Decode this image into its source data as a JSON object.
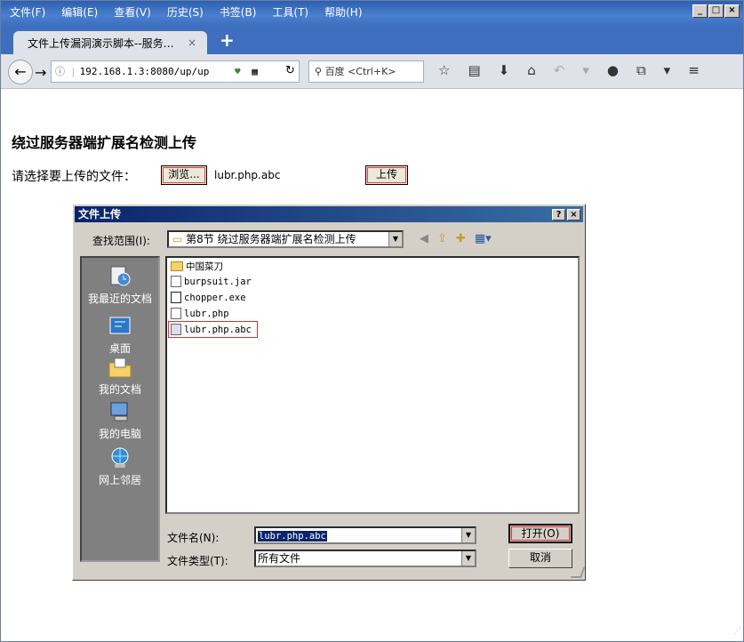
{
  "menubar": {
    "items": [
      "文件(F)",
      "编辑(E)",
      "查看(V)",
      "历史(S)",
      "书签(B)",
      "工具(T)",
      "帮助(H)"
    ],
    "window_controls": [
      "_",
      "□",
      "×"
    ]
  },
  "tab": {
    "title": "文件上传漏洞演示脚本--服务…",
    "close": "×",
    "new_tab": "+"
  },
  "navbar": {
    "url": "192.168.1.3:8080/up/up",
    "search_placeholder": "百度 <Ctrl+K>"
  },
  "page": {
    "heading": "绕过服务器端扩展名检测上传",
    "prompt": "请选择要上传的文件：",
    "browse_label": "浏览...",
    "chosen_file": "lubr.php.abc",
    "upload_label": "上传"
  },
  "dialog": {
    "title": "文件上传",
    "title_buttons": [
      "?",
      "×"
    ],
    "look_in_label": "查找范围(I):",
    "look_in_value": "第8节 绕过服务器端扩展名检测上传",
    "places": [
      "我最近的文档",
      "桌面",
      "我的文档",
      "我的电脑",
      "网上邻居"
    ],
    "files": [
      "中国菜刀",
      "burpsuit.jar",
      "chopper.exe",
      "lubr.php",
      "lubr.php.abc"
    ],
    "filename_label": "文件名(N):",
    "filename_value": "lubr.php.abc",
    "filetype_label": "文件类型(T):",
    "filetype_value": "所有文件",
    "open_label": "打开(O)",
    "cancel_label": "取消"
  }
}
